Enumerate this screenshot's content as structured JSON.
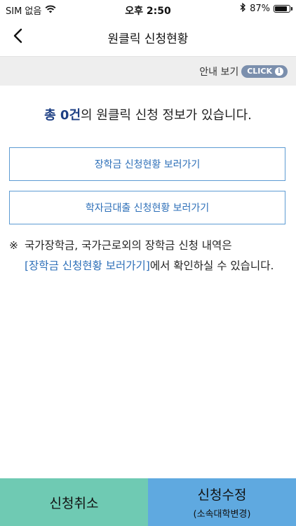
{
  "status_bar": {
    "carrier": "SIM 없음",
    "time": "오후 2:50",
    "battery": "87%",
    "battery_level": 0.87
  },
  "header": {
    "title": "원클릭 신청현황"
  },
  "guide": {
    "label": "안내 보기",
    "click_label": "CLICK",
    "info_glyph": "i"
  },
  "summary": {
    "count_text": "총 0건",
    "rest_text": "의 원클릭 신청 정보가 있습니다."
  },
  "links": {
    "scholarship": "장학금 신청현황 보러가기",
    "loan": "학자금대출 신청현황 보러가기"
  },
  "notice": {
    "mark": "※",
    "text_before": "국가장학금, 국가근로외의 장학금 신청 내역은",
    "link_text": "[장학금 신청현황 보러가기]",
    "text_after": "에서 확인하실 수 있습니다."
  },
  "bottom": {
    "cancel_label": "신청취소",
    "modify_label": "신청수정",
    "modify_sub": "(소속대학변경)"
  },
  "colors": {
    "accent_text": "#1d3f84",
    "link": "#2d6fb8",
    "cancel_bg": "#6fcab3",
    "modify_bg": "#5fa9e0",
    "click_badge": "#7b8fad"
  }
}
